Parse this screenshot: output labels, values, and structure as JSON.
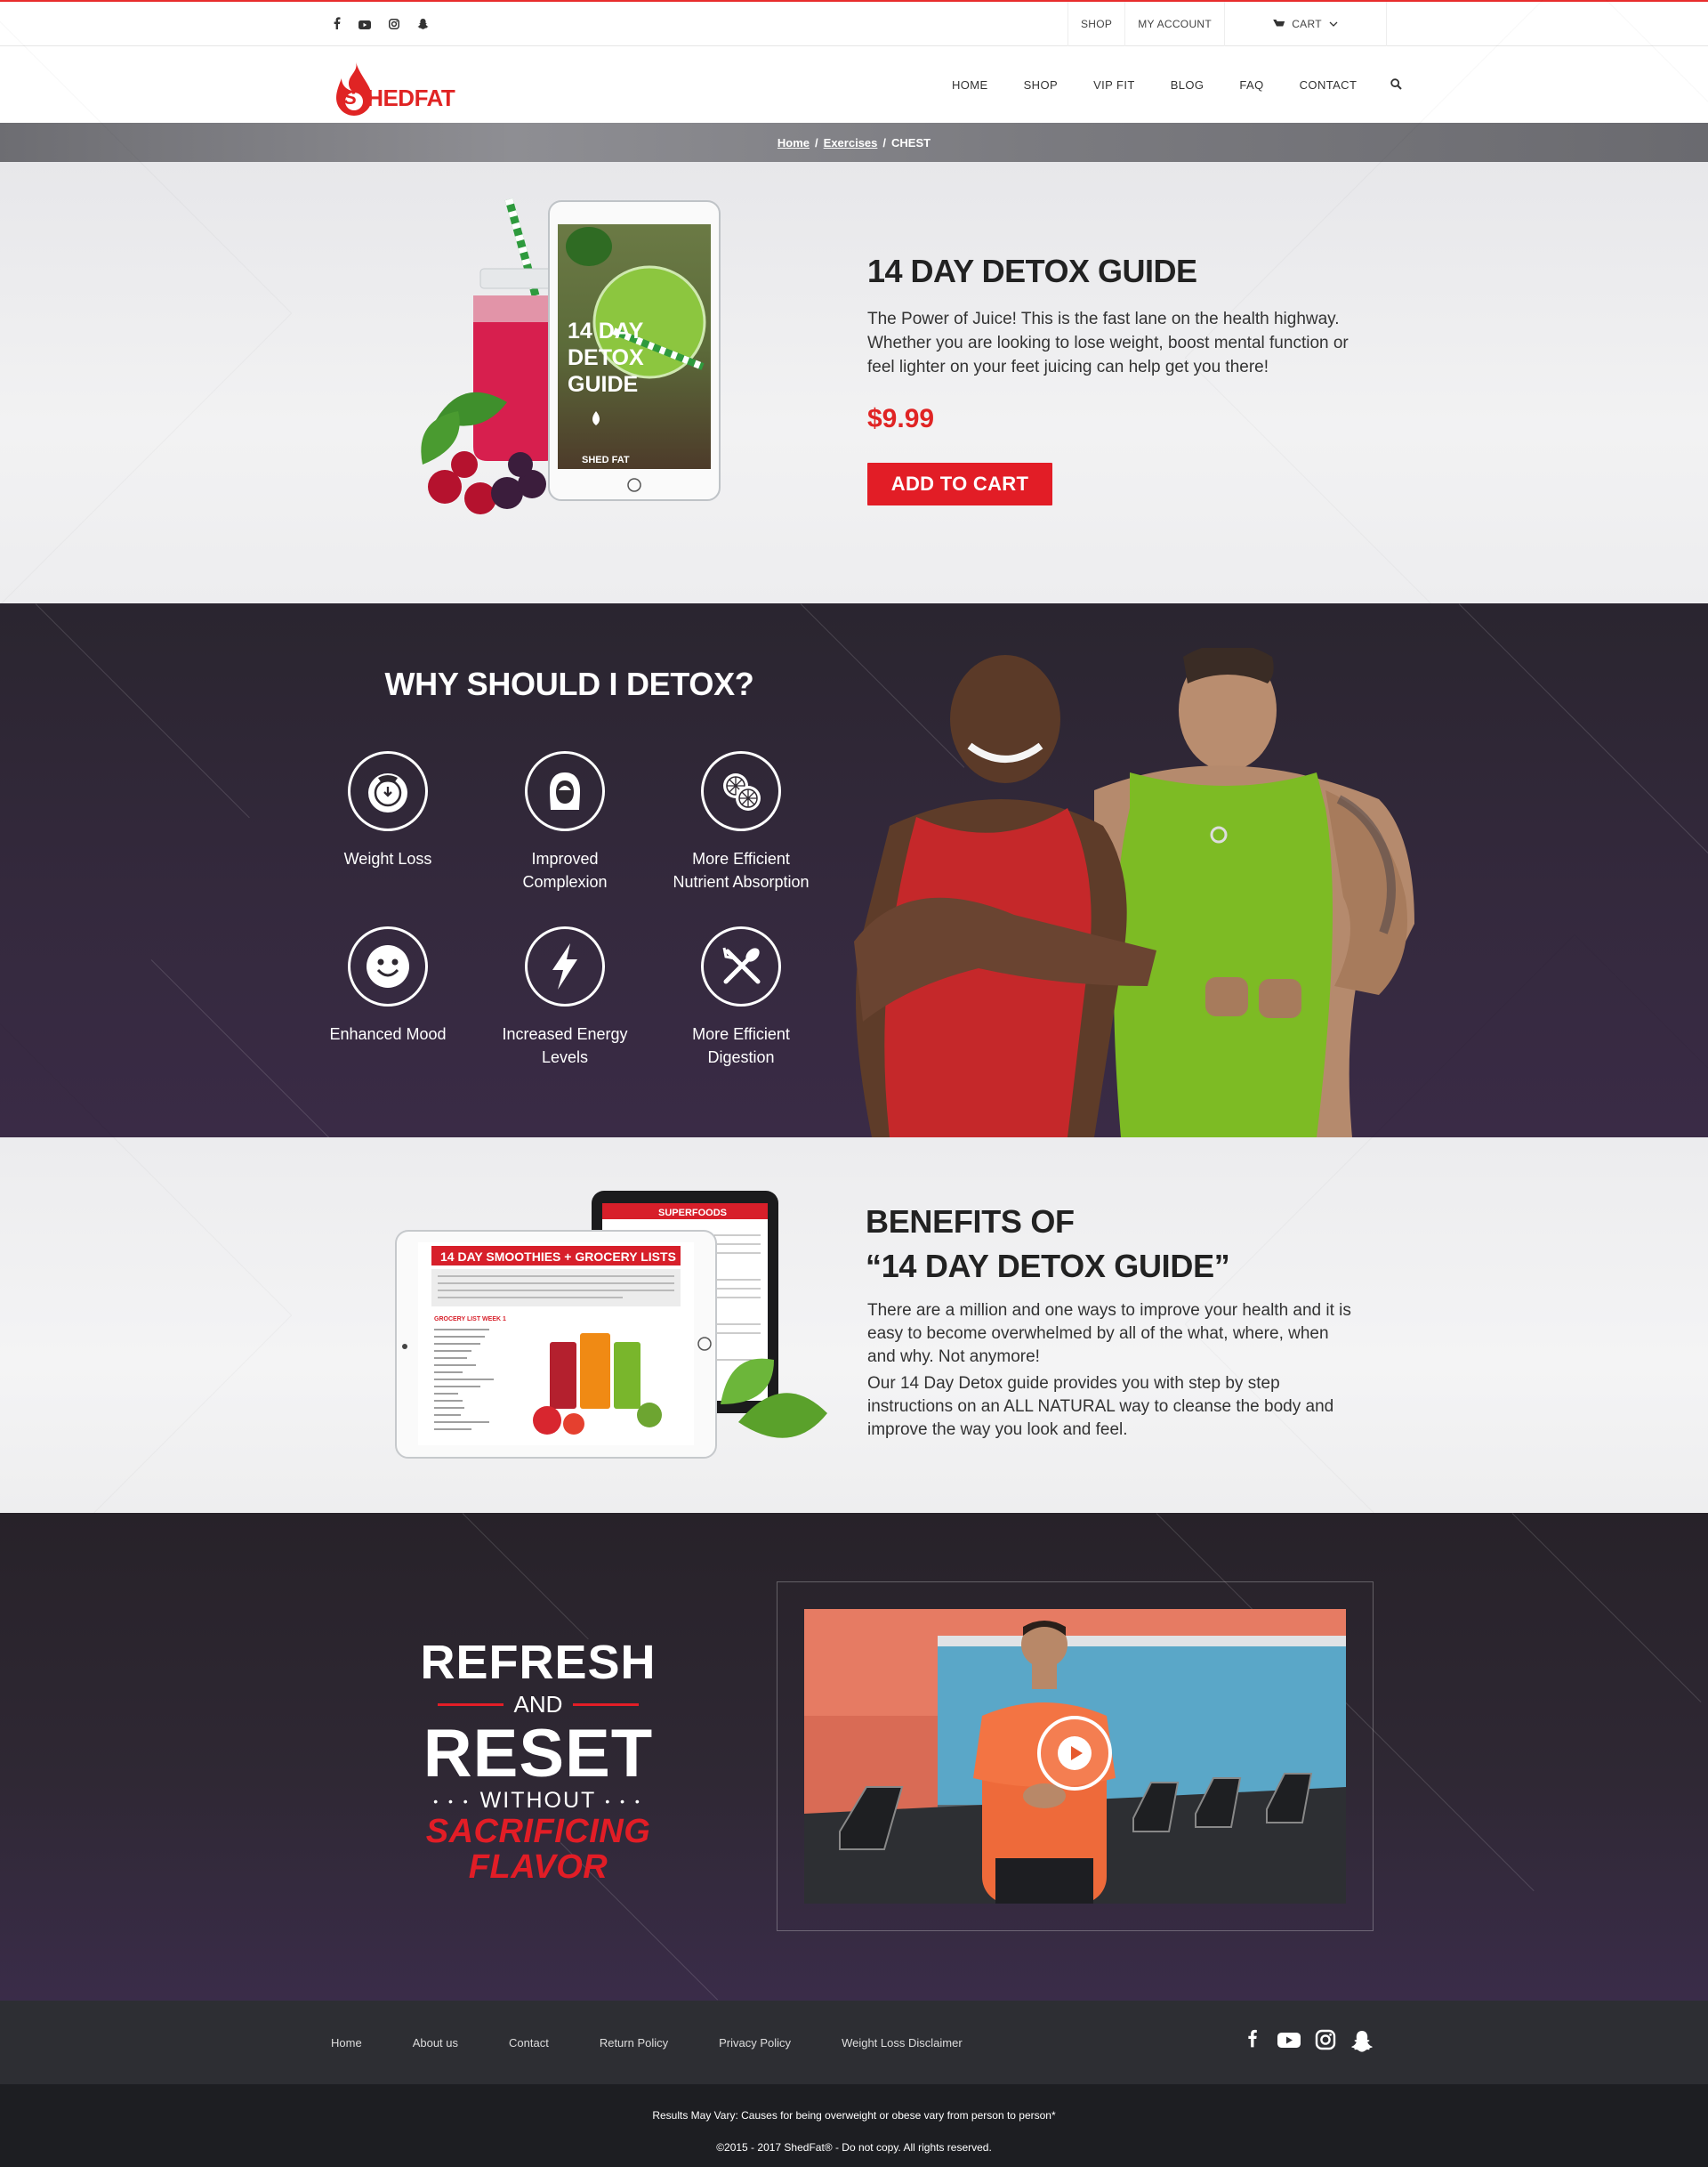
{
  "topbar": {
    "social": [
      "facebook-icon",
      "youtube-icon",
      "instagram-icon",
      "snapchat-icon"
    ],
    "shop_label": "SHOP",
    "account_label": "MY ACCOUNT",
    "cart_label": "CART"
  },
  "brand": {
    "logo_s": "S",
    "logo_rest": "HED",
    "logo_fat": "FAT",
    "accent": "#e21d26"
  },
  "nav": {
    "items": [
      "HOME",
      "SHOP",
      "VIP FIT",
      "BLOG",
      "FAQ",
      "CONTACT"
    ]
  },
  "breadcrumb": {
    "home": "Home",
    "exercises": "Exercises",
    "current": "CHEST",
    "sep": "/"
  },
  "product": {
    "title": "14 DAY DETOX GUIDE",
    "description": "The Power of Juice! This is the fast lane on the health highway. Whether you are looking to lose weight, boost mental function or feel lighter on your feet juicing can help get you there!",
    "price": "$9.99",
    "cta": "ADD TO CART",
    "tablet_title_1": "14 DAY",
    "tablet_title_2": "DETOX",
    "tablet_title_3": "GUIDE",
    "tablet_brand": "SHED FAT"
  },
  "why": {
    "title": "WHY SHOULD I DETOX?",
    "features": [
      {
        "line1": "Weight Loss",
        "line2": ""
      },
      {
        "line1": "Improved",
        "line2": "Complexion"
      },
      {
        "line1": "More Efficient",
        "line2": "Nutrient Absorption"
      },
      {
        "line1": "Enhanced Mood",
        "line2": ""
      },
      {
        "line1": "Increased Energy",
        "line2": "Levels"
      },
      {
        "line1": "More Efficient",
        "line2": "Digestion"
      }
    ]
  },
  "benefits": {
    "title_line1": "BENEFITS OF",
    "title_line2": "“14 DAY DETOX GUIDE”",
    "para1": "There are a million and one ways to improve your health and it is easy to become overwhelmed by all of the what, where, when and why.  Not anymore!",
    "para2": "Our 14 Day Detox guide provides you with step by step instructions on an ALL NATURAL way to cleanse the body and improve the way you look and feel.",
    "tablet_header": "14 DAY SMOOTHIES + GROCERY LISTS",
    "tablet_back_header": "SUPERFOODS",
    "tablet_list_title": "GROCERY LIST WEEK 1"
  },
  "promo": {
    "refresh": "REFRESH",
    "and": "AND",
    "reset": "RESET",
    "without": "WITHOUT",
    "sacrificing": "SACRIFICING",
    "flavor": "FLAVOR",
    "dots": "• • •"
  },
  "footer": {
    "links": [
      "Home",
      "About us",
      "Contact",
      "Return Policy",
      "Privacy Policy",
      "Weight Loss Disclaimer"
    ],
    "social": [
      "facebook-icon",
      "youtube-icon",
      "instagram-icon",
      "snapchat-icon"
    ],
    "disclaimer": "Results May Vary: Causes for being overweight or obese vary from person to person*",
    "copyright": "©2015 - 2017  ShedFat® - Do not copy. All rights reserved."
  }
}
